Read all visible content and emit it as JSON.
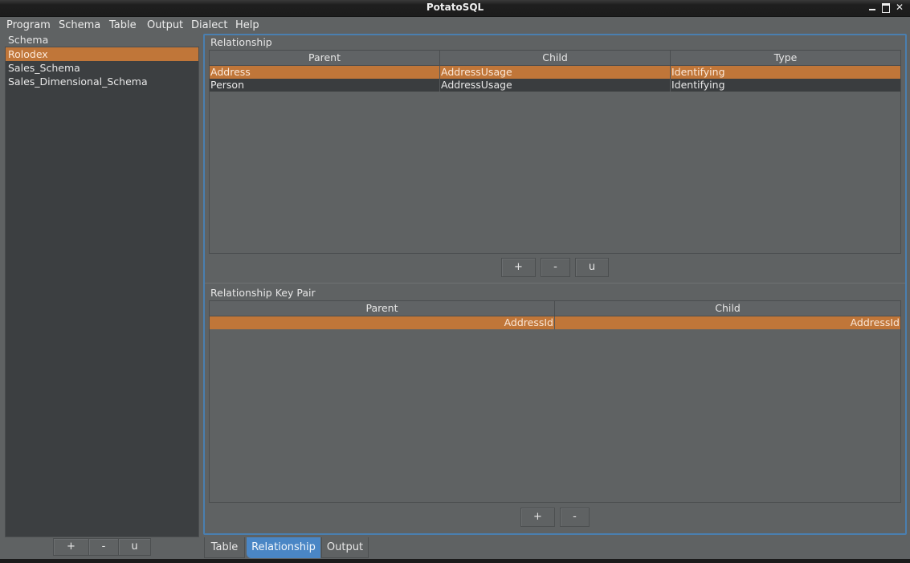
{
  "window": {
    "title": "PotatoSQL",
    "controls": [
      "minimize",
      "maximize",
      "close"
    ]
  },
  "menubar": {
    "items": [
      "Program",
      "Schema",
      "Table",
      "Output",
      "Dialect",
      "Help"
    ]
  },
  "schema_panel": {
    "label": "Schema",
    "items": [
      {
        "label": "Rolodex",
        "selected": true
      },
      {
        "label": "Sales_Schema",
        "selected": false
      },
      {
        "label": "Sales_Dimensional_Schema",
        "selected": false
      }
    ],
    "buttons": {
      "add": "+",
      "remove": "-",
      "update": "u"
    }
  },
  "relationship": {
    "label": "Relationship",
    "columns": [
      "Parent",
      "Child",
      "Type"
    ],
    "rows": [
      {
        "parent": "Address",
        "child": "AddressUsage",
        "type": "Identifying",
        "selected": true
      },
      {
        "parent": "Person",
        "child": "AddressUsage",
        "type": "Identifying",
        "selected": false
      }
    ],
    "buttons": {
      "add": "+",
      "remove": "-",
      "update": "u"
    }
  },
  "key_pair": {
    "label": "Relationship Key Pair",
    "columns": [
      "Parent",
      "Child"
    ],
    "rows": [
      {
        "parent": "AddressId",
        "child": "AddressId",
        "selected": true
      }
    ],
    "buttons": {
      "add": "+",
      "remove": "-"
    }
  },
  "tabs": [
    {
      "label": "Table",
      "active": false
    },
    {
      "label": "Relationship",
      "active": true
    },
    {
      "label": "Output",
      "active": false
    }
  ],
  "colors": {
    "selection": "#c07639",
    "accent": "#4a86c5",
    "background": "#5f6263"
  }
}
